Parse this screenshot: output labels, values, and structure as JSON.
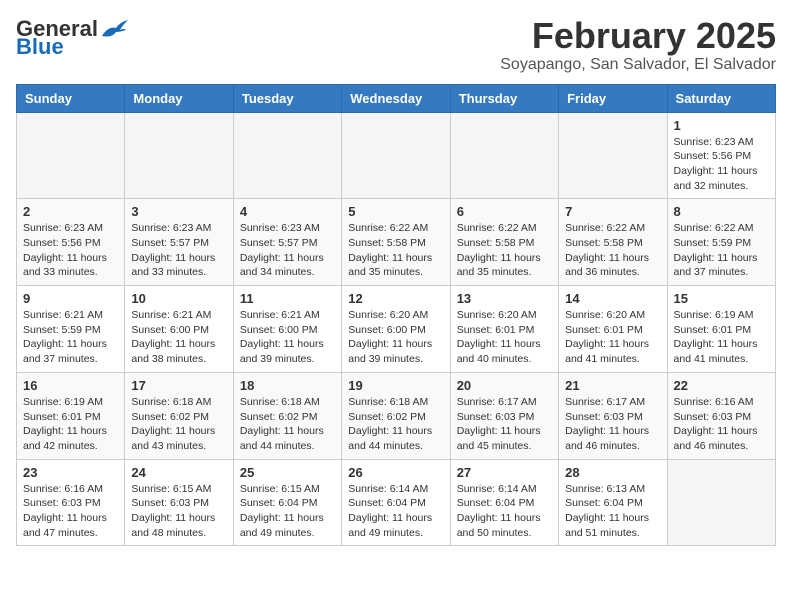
{
  "header": {
    "logo": {
      "general": "General",
      "blue": "Blue"
    },
    "title": "February 2025",
    "location": "Soyapango, San Salvador, El Salvador"
  },
  "weekdays": [
    "Sunday",
    "Monday",
    "Tuesday",
    "Wednesday",
    "Thursday",
    "Friday",
    "Saturday"
  ],
  "weeks": [
    [
      {
        "day": "",
        "info": ""
      },
      {
        "day": "",
        "info": ""
      },
      {
        "day": "",
        "info": ""
      },
      {
        "day": "",
        "info": ""
      },
      {
        "day": "",
        "info": ""
      },
      {
        "day": "",
        "info": ""
      },
      {
        "day": "1",
        "info": "Sunrise: 6:23 AM\nSunset: 5:56 PM\nDaylight: 11 hours and 32 minutes."
      }
    ],
    [
      {
        "day": "2",
        "info": "Sunrise: 6:23 AM\nSunset: 5:56 PM\nDaylight: 11 hours and 33 minutes."
      },
      {
        "day": "3",
        "info": "Sunrise: 6:23 AM\nSunset: 5:57 PM\nDaylight: 11 hours and 33 minutes."
      },
      {
        "day": "4",
        "info": "Sunrise: 6:23 AM\nSunset: 5:57 PM\nDaylight: 11 hours and 34 minutes."
      },
      {
        "day": "5",
        "info": "Sunrise: 6:22 AM\nSunset: 5:58 PM\nDaylight: 11 hours and 35 minutes."
      },
      {
        "day": "6",
        "info": "Sunrise: 6:22 AM\nSunset: 5:58 PM\nDaylight: 11 hours and 35 minutes."
      },
      {
        "day": "7",
        "info": "Sunrise: 6:22 AM\nSunset: 5:58 PM\nDaylight: 11 hours and 36 minutes."
      },
      {
        "day": "8",
        "info": "Sunrise: 6:22 AM\nSunset: 5:59 PM\nDaylight: 11 hours and 37 minutes."
      }
    ],
    [
      {
        "day": "9",
        "info": "Sunrise: 6:21 AM\nSunset: 5:59 PM\nDaylight: 11 hours and 37 minutes."
      },
      {
        "day": "10",
        "info": "Sunrise: 6:21 AM\nSunset: 6:00 PM\nDaylight: 11 hours and 38 minutes."
      },
      {
        "day": "11",
        "info": "Sunrise: 6:21 AM\nSunset: 6:00 PM\nDaylight: 11 hours and 39 minutes."
      },
      {
        "day": "12",
        "info": "Sunrise: 6:20 AM\nSunset: 6:00 PM\nDaylight: 11 hours and 39 minutes."
      },
      {
        "day": "13",
        "info": "Sunrise: 6:20 AM\nSunset: 6:01 PM\nDaylight: 11 hours and 40 minutes."
      },
      {
        "day": "14",
        "info": "Sunrise: 6:20 AM\nSunset: 6:01 PM\nDaylight: 11 hours and 41 minutes."
      },
      {
        "day": "15",
        "info": "Sunrise: 6:19 AM\nSunset: 6:01 PM\nDaylight: 11 hours and 41 minutes."
      }
    ],
    [
      {
        "day": "16",
        "info": "Sunrise: 6:19 AM\nSunset: 6:01 PM\nDaylight: 11 hours and 42 minutes."
      },
      {
        "day": "17",
        "info": "Sunrise: 6:18 AM\nSunset: 6:02 PM\nDaylight: 11 hours and 43 minutes."
      },
      {
        "day": "18",
        "info": "Sunrise: 6:18 AM\nSunset: 6:02 PM\nDaylight: 11 hours and 44 minutes."
      },
      {
        "day": "19",
        "info": "Sunrise: 6:18 AM\nSunset: 6:02 PM\nDaylight: 11 hours and 44 minutes."
      },
      {
        "day": "20",
        "info": "Sunrise: 6:17 AM\nSunset: 6:03 PM\nDaylight: 11 hours and 45 minutes."
      },
      {
        "day": "21",
        "info": "Sunrise: 6:17 AM\nSunset: 6:03 PM\nDaylight: 11 hours and 46 minutes."
      },
      {
        "day": "22",
        "info": "Sunrise: 6:16 AM\nSunset: 6:03 PM\nDaylight: 11 hours and 46 minutes."
      }
    ],
    [
      {
        "day": "23",
        "info": "Sunrise: 6:16 AM\nSunset: 6:03 PM\nDaylight: 11 hours and 47 minutes."
      },
      {
        "day": "24",
        "info": "Sunrise: 6:15 AM\nSunset: 6:03 PM\nDaylight: 11 hours and 48 minutes."
      },
      {
        "day": "25",
        "info": "Sunrise: 6:15 AM\nSunset: 6:04 PM\nDaylight: 11 hours and 49 minutes."
      },
      {
        "day": "26",
        "info": "Sunrise: 6:14 AM\nSunset: 6:04 PM\nDaylight: 11 hours and 49 minutes."
      },
      {
        "day": "27",
        "info": "Sunrise: 6:14 AM\nSunset: 6:04 PM\nDaylight: 11 hours and 50 minutes."
      },
      {
        "day": "28",
        "info": "Sunrise: 6:13 AM\nSunset: 6:04 PM\nDaylight: 11 hours and 51 minutes."
      },
      {
        "day": "",
        "info": ""
      }
    ]
  ]
}
